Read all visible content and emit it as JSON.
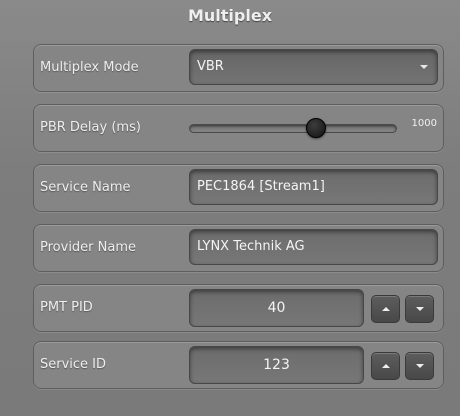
{
  "title": "Multiplex",
  "rows": {
    "mode": {
      "label": "Multiplex Mode",
      "value": "VBR"
    },
    "pbr": {
      "label": "PBR Delay (ms)",
      "value_label": "1000",
      "slider_fraction": 0.62
    },
    "service_name": {
      "label": "Service Name",
      "value": "PEC1864 [Stream1]"
    },
    "provider_name": {
      "label": "Provider Name",
      "value": "LYNX Technik AG"
    },
    "pmt_pid": {
      "label": "PMT PID",
      "value": "40"
    },
    "service_id": {
      "label": "Service ID",
      "value": "123"
    }
  },
  "icons": {
    "select_caret": "chevron-down-icon",
    "step_up": "triangle-up-icon",
    "step_down": "triangle-down-icon"
  }
}
